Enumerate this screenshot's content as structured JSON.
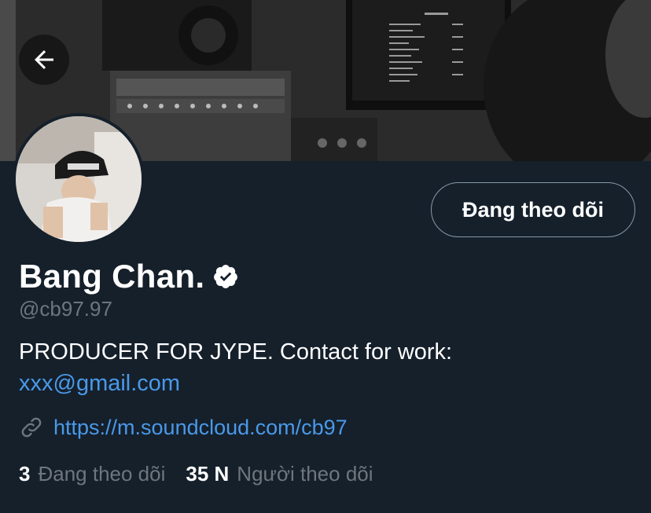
{
  "header": {
    "back_icon": "arrow-left-icon"
  },
  "profile": {
    "name": "Bang Chan.",
    "verified_icon": "verified-badge-icon",
    "handle": "@cb97.97",
    "bio_text": "PRODUCER FOR JYPE. Contact for work:",
    "bio_email": "xxx@gmail.com",
    "link_icon": "link-icon",
    "website": "https://m.soundcloud.com/cb97",
    "follow_button_label": "Đang theo dõi",
    "following_count": "3",
    "following_label": "Đang theo dõi",
    "followers_count": "35 N",
    "followers_label": "Người theo dõi"
  },
  "colors": {
    "background": "#15202b",
    "link": "#4a99e9",
    "muted": "#6e767d",
    "button_border": "#8899a6"
  }
}
